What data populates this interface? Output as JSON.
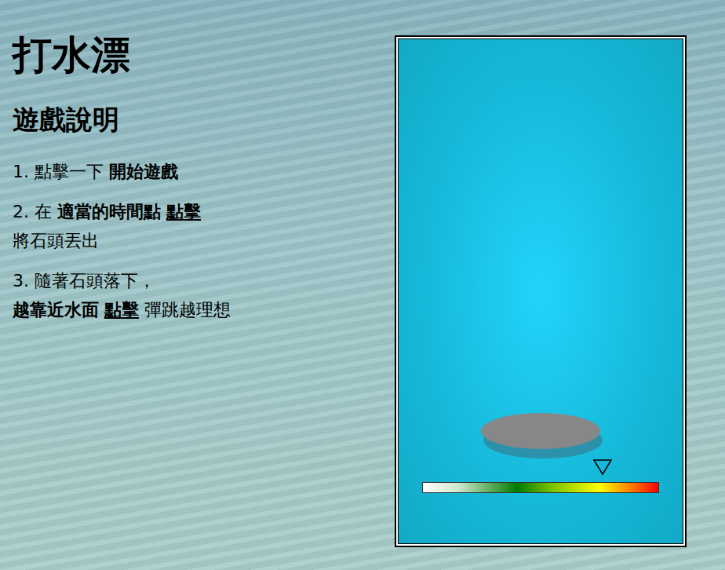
{
  "title": "打水漂",
  "instructions_heading": "遊戲說明",
  "instructions": [
    {
      "lines": [
        [
          {
            "text": "1. 點擊一下 ",
            "bold": false,
            "underline": false
          },
          {
            "text": "開始遊戲",
            "bold": true,
            "underline": false
          }
        ]
      ]
    },
    {
      "lines": [
        [
          {
            "text": "2. 在 ",
            "bold": false,
            "underline": false
          },
          {
            "text": "適當的時間點",
            "bold": true,
            "underline": false
          },
          {
            "text": " ",
            "bold": false,
            "underline": false
          },
          {
            "text": "點擊",
            "bold": true,
            "underline": true
          }
        ],
        [
          {
            "text": "將石頭丟出",
            "bold": false,
            "underline": false
          }
        ]
      ]
    },
    {
      "lines": [
        [
          {
            "text": "3. 隨著石頭落下，",
            "bold": false,
            "underline": false
          }
        ],
        [
          {
            "text": "越靠近水面",
            "bold": true,
            "underline": false
          },
          {
            "text": " ",
            "bold": false,
            "underline": false
          },
          {
            "text": "點擊",
            "bold": true,
            "underline": true
          },
          {
            "text": " 彈跳越理想",
            "bold": false,
            "underline": false
          }
        ]
      ]
    }
  ],
  "power_meter": {
    "level": 0.76
  }
}
